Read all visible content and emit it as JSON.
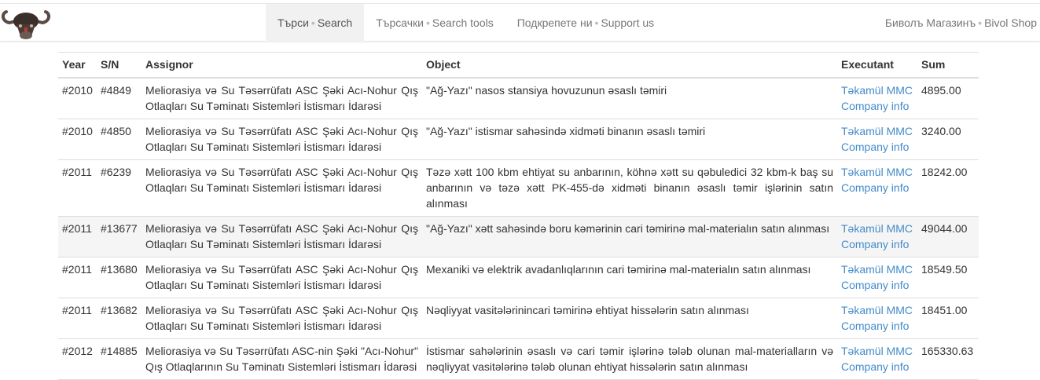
{
  "nav": {
    "items": [
      {
        "bg": "Търси",
        "en": "Search"
      },
      {
        "bg": "Търсачки",
        "en": "Search tools"
      },
      {
        "bg": "Подкрепете ни",
        "en": "Support us"
      }
    ],
    "shop": {
      "bg": "Биволъ Магазинъ",
      "en": "Bivol Shop"
    },
    "separator": "•"
  },
  "table": {
    "headers": {
      "year": "Year",
      "sn": "S/N",
      "assignor": "Assignor",
      "object": "Object",
      "executant": "Executant",
      "sum": "Sum"
    },
    "rows": [
      {
        "year": "#2010",
        "sn": "#4849",
        "assignor": "Meliorasiya və Su Təsərrüfatı ASC Şəki Acı-Nohur Qış Otlaqları Su Təminatı Sistemləri İstismarı İdarəsi",
        "object": "\"Ağ-Yazı\" nasos stansiya hovuzunun əsaslı təmiri",
        "executant": "Təkamül MMC",
        "company_info": "Company info",
        "sum": "4895.00"
      },
      {
        "year": "#2010",
        "sn": "#4850",
        "assignor": "Meliorasiya və Su Təsərrüfatı ASC Şəki Acı-Nohur Qış Otlaqları Su Təminatı Sistemləri İstismarı İdarəsi",
        "object": "\"Ağ-Yazı\" istismar sahəsində xidməti binanın əsaslı təmiri",
        "executant": "Təkamül MMC",
        "company_info": "Company info",
        "sum": "3240.00"
      },
      {
        "year": "#2011",
        "sn": "#6239",
        "assignor": "Meliorasiya və Su Təsərrüfatı ASC Şəki Acı-Nohur Qış Otlaqları Su Təminatı Sistemləri İstismarı İdarəsi",
        "object": "Təzə xətt 100 kbm ehtiyat su anbarının, köhnə xətt su qəbuledici 32 kbm-k baş su anbarının və təzə xətt PK-455-də xidməti binanın əsaslı təmir işlərinin satın alınması",
        "executant": "Təkamül MMC",
        "company_info": "Company info",
        "sum": "18242.00"
      },
      {
        "year": "#2011",
        "sn": "#13677",
        "assignor": "Meliorasiya və Su Təsərrüfatı ASC Şəki Acı-Nohur Qış Otlaqları Su Təminatı Sistemləri İstismarı İdarəsi",
        "object": "\"Ağ-Yazı\" xətt sahəsində boru kəmərinin cari təmirinə mal-materialın satın alınması",
        "executant": "Təkamül MMC",
        "company_info": "Company info",
        "sum": "49044.00"
      },
      {
        "year": "#2011",
        "sn": "#13680",
        "assignor": "Meliorasiya və Su Təsərrüfatı ASC Şəki Acı-Nohur Qış Otlaqları Su Təminatı Sistemləri İstismarı İdarəsi",
        "object": "Mexaniki və elektrik avadanlıqlarının cari təmirinə mal-materialın satın alınması",
        "executant": "Təkamül MMC",
        "company_info": "Company info",
        "sum": "18549.50"
      },
      {
        "year": "#2011",
        "sn": "#13682",
        "assignor": "Meliorasiya və Su Təsərrüfatı ASC Şəki Acı-Nohur Qış Otlaqları Su Təminatı Sistemləri İstismarı İdarəsi",
        "object": "Nəqliyyat vasitələrinincari təmirinə ehtiyat hissələrin satın alınması",
        "executant": "Təkamül MMC",
        "company_info": "Company info",
        "sum": "18451.00"
      },
      {
        "year": "#2012",
        "sn": "#14885",
        "assignor": "Meliorasiya və Su Təsərrüfatı ASC-nin Şəki \"Acı-Nohur\" Qış Otlaqlarının Su Təminatı Sistemləri İstismarı İdarəsi",
        "object": "İstismar sahələrinin əsaslı və cari təmir işlərinə tələb olunan mal-materialların və nəqliyyat vasitələrinə tələb olunan ehtiyat hissələrin satın alınması",
        "executant": "Təkamül MMC",
        "company_info": "Company info",
        "sum": "165330.63"
      }
    ]
  },
  "colors": {
    "link": "#428bca",
    "highlight_row": "#f5f5f5",
    "nav_active": "#f1f1f1"
  },
  "icons": {
    "logo": "buffalo-logo"
  }
}
